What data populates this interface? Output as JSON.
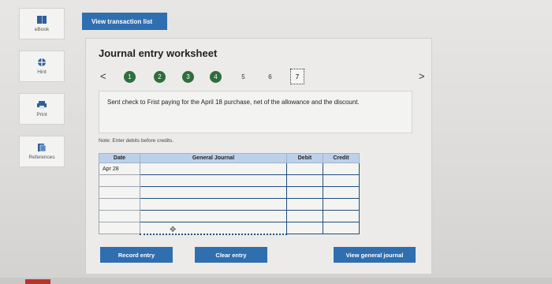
{
  "sidebar": {
    "items": [
      {
        "label": "eBook",
        "icon": "book-icon"
      },
      {
        "label": "Hint",
        "icon": "globe-icon"
      },
      {
        "label": "Print",
        "icon": "printer-icon"
      },
      {
        "label": "References",
        "icon": "references-icon"
      }
    ]
  },
  "header": {
    "view_transactions_label": "View transaction list"
  },
  "worksheet": {
    "title": "Journal entry worksheet",
    "nav": {
      "prev_symbol": "<",
      "next_symbol": ">",
      "steps": [
        {
          "label": "1",
          "state": "done"
        },
        {
          "label": "2",
          "state": "done"
        },
        {
          "label": "3",
          "state": "done"
        },
        {
          "label": "4",
          "state": "done"
        },
        {
          "label": "5",
          "state": "todo"
        },
        {
          "label": "6",
          "state": "todo"
        },
        {
          "label": "7",
          "state": "active"
        }
      ]
    },
    "description": "Sent check to Frist paying for the April 18 purchase, net of the allowance and the discount.",
    "note": "Note: Enter debits before credits.",
    "table": {
      "headers": {
        "date": "Date",
        "account": "General Journal",
        "debit": "Debit",
        "credit": "Credit"
      },
      "rows": [
        {
          "date": "Apr 28",
          "account": "",
          "debit": "",
          "credit": ""
        },
        {
          "date": "",
          "account": "",
          "debit": "",
          "credit": ""
        },
        {
          "date": "",
          "account": "",
          "debit": "",
          "credit": ""
        },
        {
          "date": "",
          "account": "",
          "debit": "",
          "credit": ""
        },
        {
          "date": "",
          "account": "",
          "debit": "",
          "credit": ""
        },
        {
          "date": "",
          "account": "",
          "debit": "",
          "credit": ""
        }
      ]
    },
    "buttons": {
      "record": "Record entry",
      "clear": "Clear entry",
      "view_general": "View general journal"
    }
  },
  "colors": {
    "primary_blue": "#2f6fb0",
    "step_done_green": "#2f6e3a",
    "table_header": "#bcd1e9"
  }
}
